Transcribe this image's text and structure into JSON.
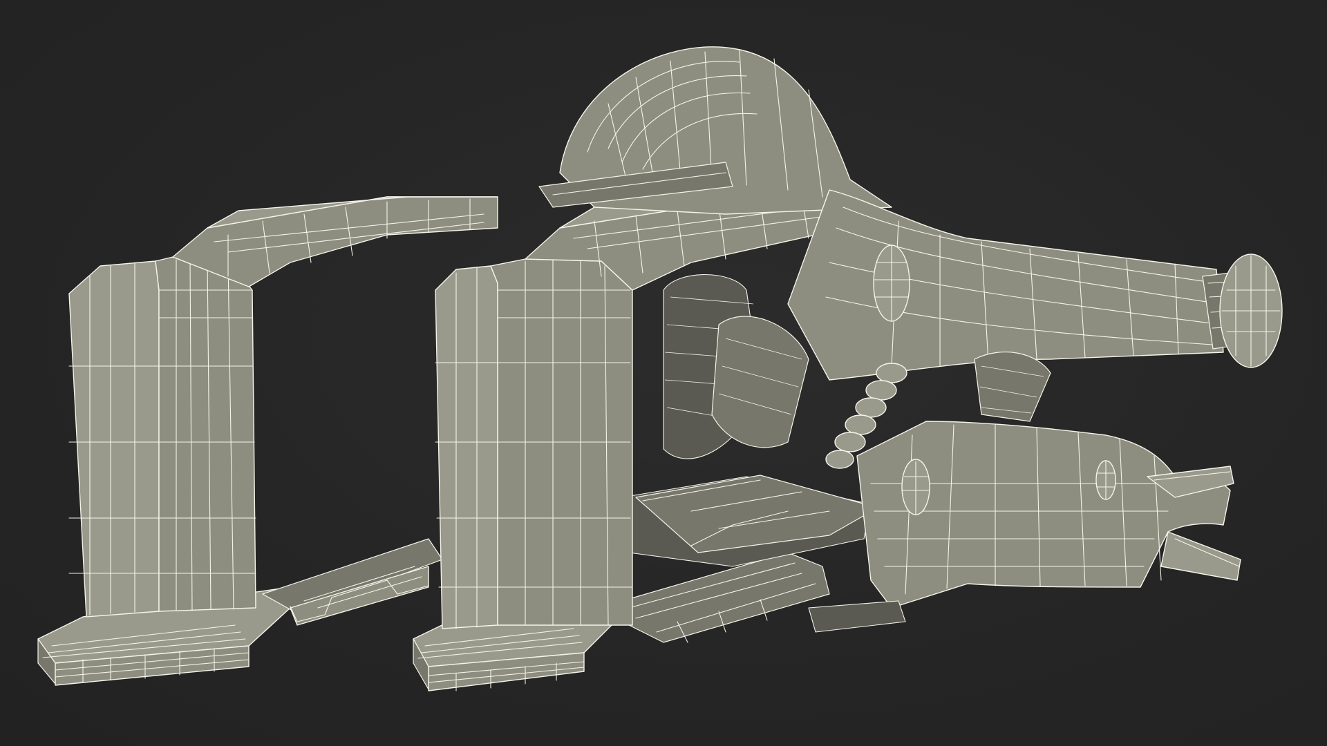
{
  "scene": {
    "subject": "wireframe-3d-model",
    "colors": {
      "background": "#262626",
      "surface": "#8e8e80",
      "surface_light": "#9a9a8c",
      "surface_dark": "#77776b",
      "shadow": "#5a5a52",
      "wire": "#f4f4ea"
    }
  }
}
